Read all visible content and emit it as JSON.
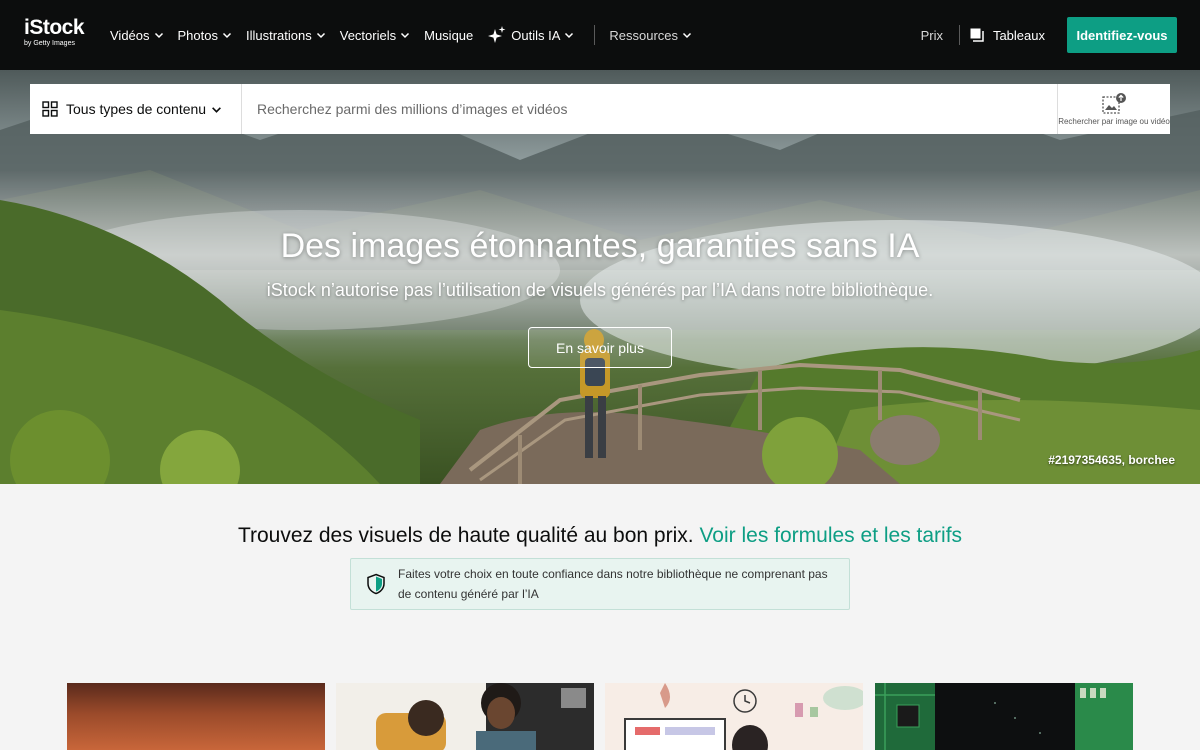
{
  "header": {
    "logo_brand": "iStock",
    "logo_sub": "by Getty Images",
    "nav": [
      {
        "label": "Vidéos",
        "chevron": true
      },
      {
        "label": "Photos",
        "chevron": true
      },
      {
        "label": "Illustrations",
        "chevron": true
      },
      {
        "label": "Vectoriels",
        "chevron": true
      },
      {
        "label": "Musique",
        "chevron": false
      },
      {
        "label": "Outils IA",
        "chevron": true
      }
    ],
    "resources_label": "Ressources",
    "pricing_label": "Prix",
    "boards_label": "Tableaux",
    "login_label": "Identifiez-vous",
    "accent_color": "#0d9e84"
  },
  "search": {
    "content_type": "Tous types de contenu",
    "placeholder": "Recherchez parmi des millions d’images et vidéos",
    "visual_search_label": "Rechercher par image ou vidéo"
  },
  "hero": {
    "title": "Des images étonnantes, garanties sans IA",
    "subtitle": "iStock n’autorise pas l’utilisation de visuels générés par l’IA dans notre bibliothèque.",
    "button_label": "En savoir plus",
    "credit": "#2197354635, borchee"
  },
  "promo": {
    "text": "Trouvez des visuels de haute qualité au bon prix.",
    "link": "Voir les formules et les tarifs",
    "trust_text": "Faites votre choix en toute confiance dans notre bibliothèque ne comprenant pas de contenu généré par l’IA"
  }
}
